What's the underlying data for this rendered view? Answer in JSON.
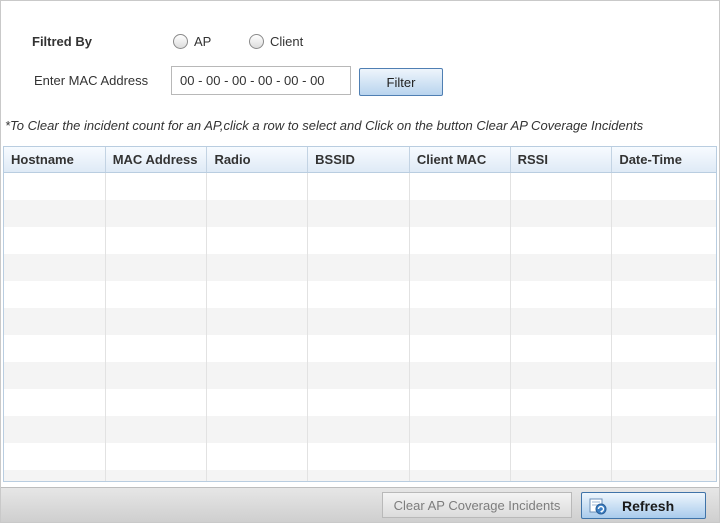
{
  "filter": {
    "label": "Filtred By",
    "options": [
      {
        "label": "AP",
        "selected": false
      },
      {
        "label": "Client",
        "selected": false
      }
    ]
  },
  "mac": {
    "label": "Enter MAC Address",
    "value": "00 - 00 - 00 - 00 - 00 - 00"
  },
  "filter_button": "Filter",
  "note": "*To Clear the incident count for an AP,click a row to select and Click on the button Clear AP Coverage Incidents",
  "table": {
    "columns": [
      "Hostname",
      "MAC Address",
      "Radio",
      "BSSID",
      "Client MAC",
      "RSSI",
      "Date-Time"
    ],
    "rows": []
  },
  "actions": {
    "clear_label": "Clear AP Coverage Incidents",
    "refresh_label": "Refresh",
    "refresh_icon": "refresh-icon"
  },
  "colors": {
    "header_bg": "#dfeaf6",
    "button_blue": "#a9cbec",
    "row_alt": "#f4f4f4"
  }
}
